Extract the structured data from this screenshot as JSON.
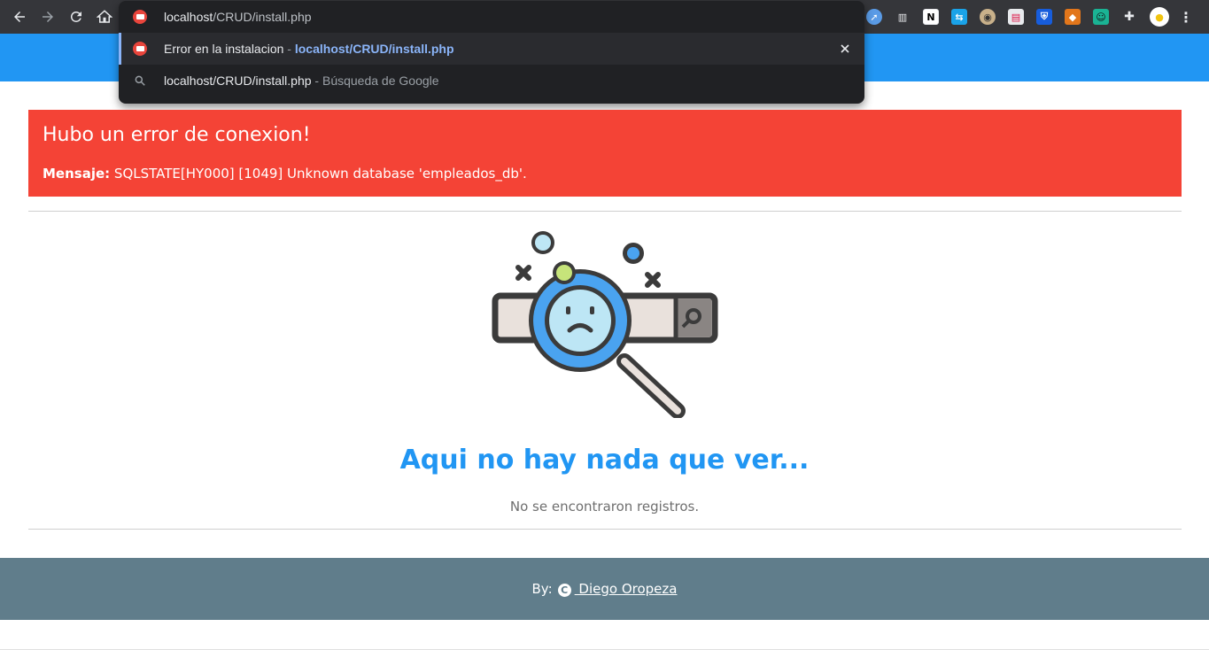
{
  "browser": {
    "address_host": "localhost",
    "address_path": "/CRUD/install.php",
    "extensions": [
      "compass-ext-icon",
      "jar-ext-icon",
      "notion-ext-icon",
      "translate-ext-icon",
      "owl-ext-icon",
      "card-ext-icon",
      "bitwarden-ext-icon",
      "metamask-ext-icon",
      "robot-ext-icon",
      "puzzle-extensions-icon",
      "pacman-profile-icon",
      "menu-kebab-icon"
    ]
  },
  "omnibox": {
    "suggestions": [
      {
        "title": "Error en la instalacion",
        "sep": " - ",
        "url": "localhost/CRUD/install.php"
      },
      {
        "query": "localhost/CRUD/install.php",
        "sep": " - ",
        "source": "Búsqueda de Google"
      }
    ]
  },
  "alert": {
    "title": "Hubo un error de conexion!",
    "label": "Mensaje:",
    "message": " SQLSTATE[HY000] [1049] Unknown database 'empleados_db'.",
    "color": "#f44336"
  },
  "empty_state": {
    "title": "Aqui no hay nada que ver...",
    "subtitle": "No se encontraron registros."
  },
  "footer": {
    "by": "By:",
    "author": " Diego Oropeza",
    "color": "#607d8b"
  },
  "colors": {
    "primary": "#2196f3",
    "toolbar": "#35363a",
    "omnibox": "#202124"
  }
}
